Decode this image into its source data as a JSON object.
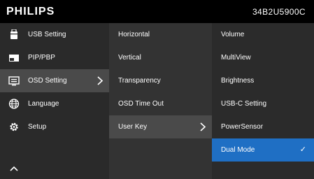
{
  "brand": "PHILIPS",
  "model": "34B2U5900C",
  "menu": [
    {
      "label": "USB Setting",
      "icon": "usb-drive-icon"
    },
    {
      "label": "PIP/PBP",
      "icon": "pip-icon"
    },
    {
      "label": "OSD Setting",
      "icon": "osd-monitor-icon"
    },
    {
      "label": "Language",
      "icon": "globe-icon"
    },
    {
      "label": "Setup",
      "icon": "gear-icon"
    }
  ],
  "submenu": [
    "Horizontal",
    "Vertical",
    "Transparency",
    "OSD Time Out",
    "User Key"
  ],
  "options": [
    "Volume",
    "MultiView",
    "Brightness",
    "USB-C Setting",
    "PowerSensor",
    "Dual Mode"
  ],
  "check_mark": "✓",
  "colors": {
    "accent": "#1f6fc4",
    "selected": "#4a4a4a"
  }
}
